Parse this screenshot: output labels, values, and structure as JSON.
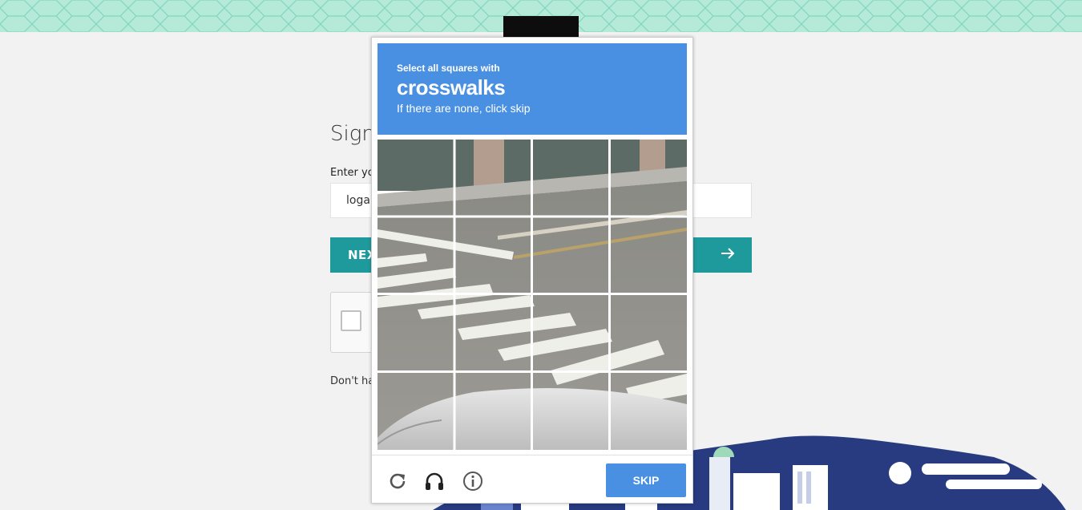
{
  "page": {
    "signin_title": "Sign",
    "email_label": "Enter yo",
    "email_value": "logar",
    "next_label": "NEX",
    "dont_have": "Don't hav",
    "colors": {
      "teal": "#1e9a9c",
      "band": "#b5ead8",
      "captcha_blue": "#4a90e2",
      "city_navy": "#283a80"
    }
  },
  "captcha": {
    "instruction": "Select all squares with",
    "target": "crosswalks",
    "hint": "If there are none, click skip",
    "grid": {
      "rows": 4,
      "cols": 4
    },
    "footer": {
      "icons": [
        "reload-icon",
        "headphones-icon",
        "info-icon"
      ],
      "skip_label": "SKIP"
    }
  }
}
